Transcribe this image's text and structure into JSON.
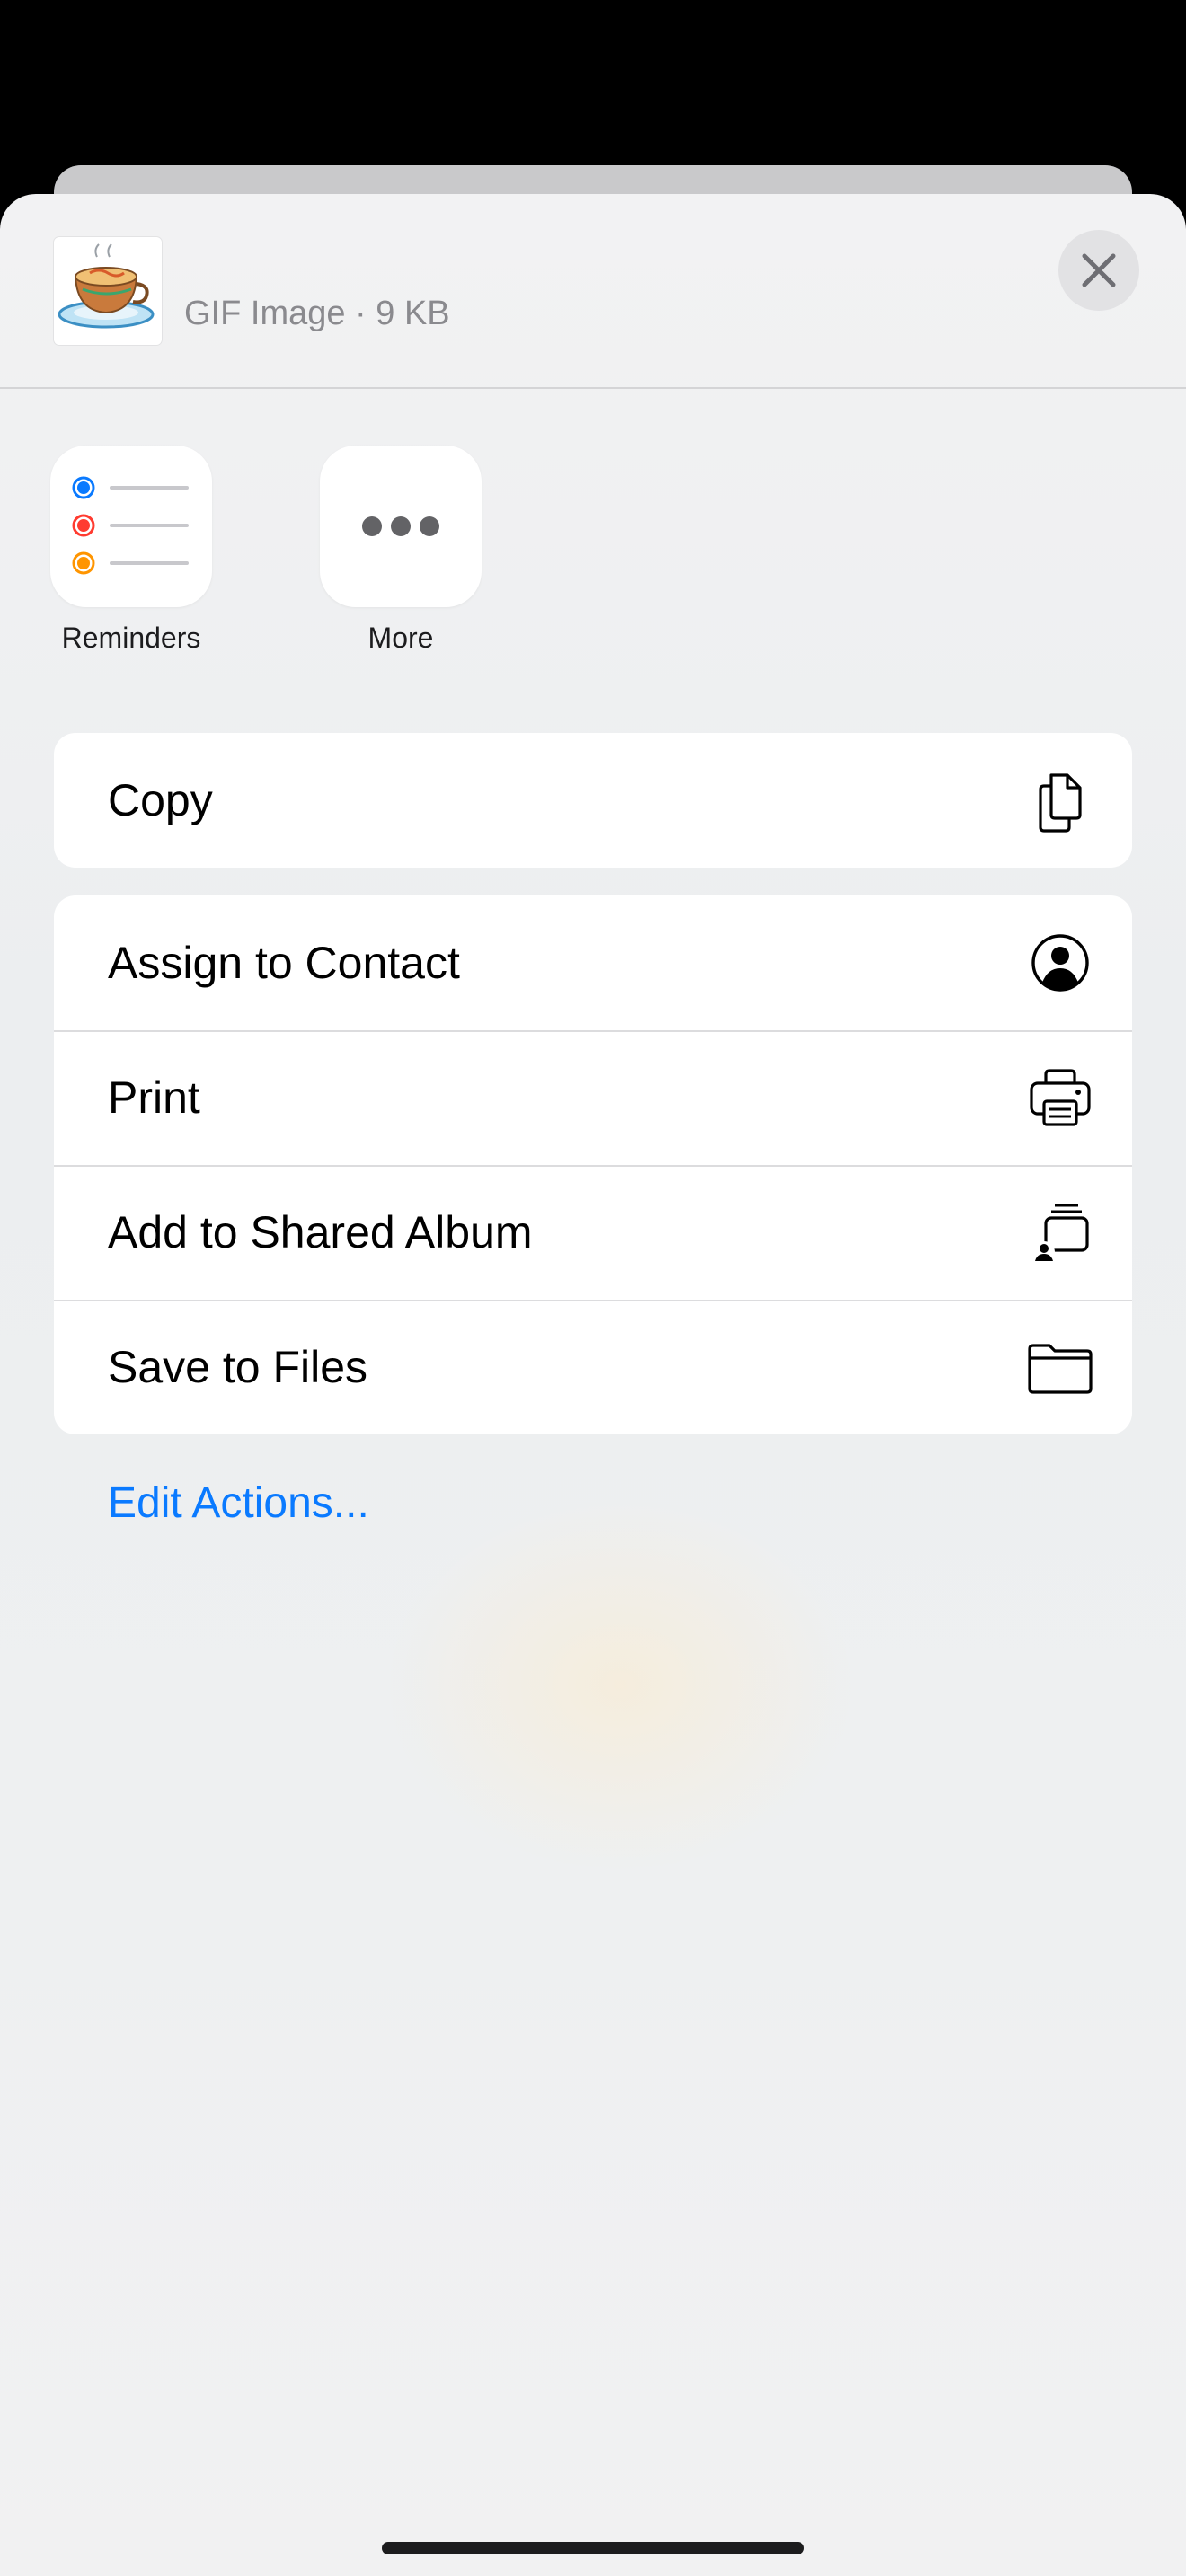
{
  "header": {
    "file_info": "GIF Image · 9 KB"
  },
  "apps": [
    {
      "label": "Reminders",
      "icon": "reminders-icon"
    },
    {
      "label": "More",
      "icon": "more-icon"
    }
  ],
  "actions_group_1": [
    {
      "label": "Copy",
      "icon": "copy-icon"
    }
  ],
  "actions_group_2": [
    {
      "label": "Assign to Contact",
      "icon": "person-circle-icon"
    },
    {
      "label": "Print",
      "icon": "printer-icon"
    },
    {
      "label": "Add to Shared Album",
      "icon": "shared-album-icon"
    },
    {
      "label": "Save to Files",
      "icon": "folder-icon"
    }
  ],
  "edit_actions": "Edit Actions...",
  "colors": {
    "accent": "#0a7aff",
    "reminder_blue": "#0a7aff",
    "reminder_red": "#ff3b30",
    "reminder_orange": "#ff9500"
  }
}
